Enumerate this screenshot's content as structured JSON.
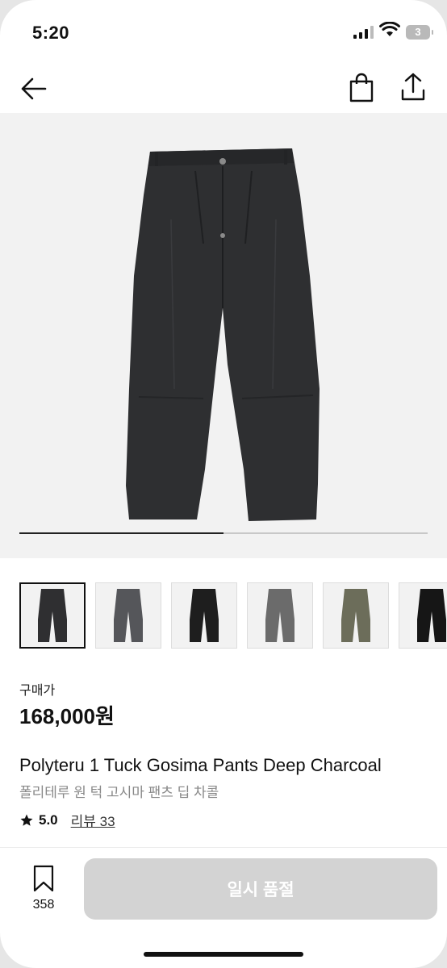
{
  "status_bar": {
    "time": "5:20",
    "battery": "3"
  },
  "header": {
    "back_icon": "arrow-left-icon",
    "bag_icon": "shopping-bag-icon",
    "share_icon": "share-icon"
  },
  "gallery": {
    "progress": 0.5,
    "thumbnail_colors": [
      "#2f2f31",
      "#55565a",
      "#1e1e1e",
      "#6b6b6b",
      "#6c6d5a",
      "#161616"
    ]
  },
  "product": {
    "price_label": "구매가",
    "price": "168,000원",
    "name_en": "Polyteru 1 Tuck Gosima Pants Deep Charcoal",
    "name_ko": "폴리테루 원 턱 고시마 팬츠 딥 차콜",
    "rating": "5.0",
    "review_label": "리뷰 33"
  },
  "bottom_bar": {
    "wish_count": "358",
    "buy_label": "일시 품절"
  },
  "colors": {
    "accent": "#111111",
    "disabled": "#d3d3d3",
    "image_bg": "#f2f2f2"
  }
}
